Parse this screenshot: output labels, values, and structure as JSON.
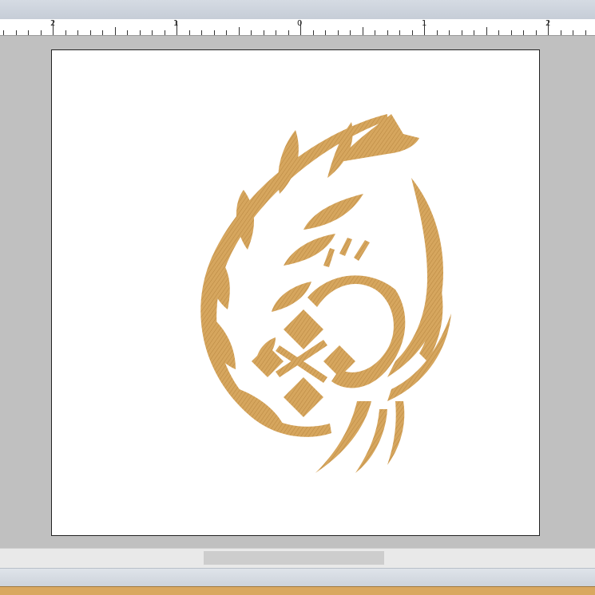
{
  "ruler": {
    "labels": [
      "2",
      "1",
      "0",
      "1",
      "2"
    ]
  },
  "colors": {
    "thread": "#d6a65e",
    "thread_dark": "#b8863f",
    "page": "#ffffff",
    "workspace": "#c0c0c0"
  },
  "design": {
    "icon": "embroidery-bird-wreath-icon"
  }
}
